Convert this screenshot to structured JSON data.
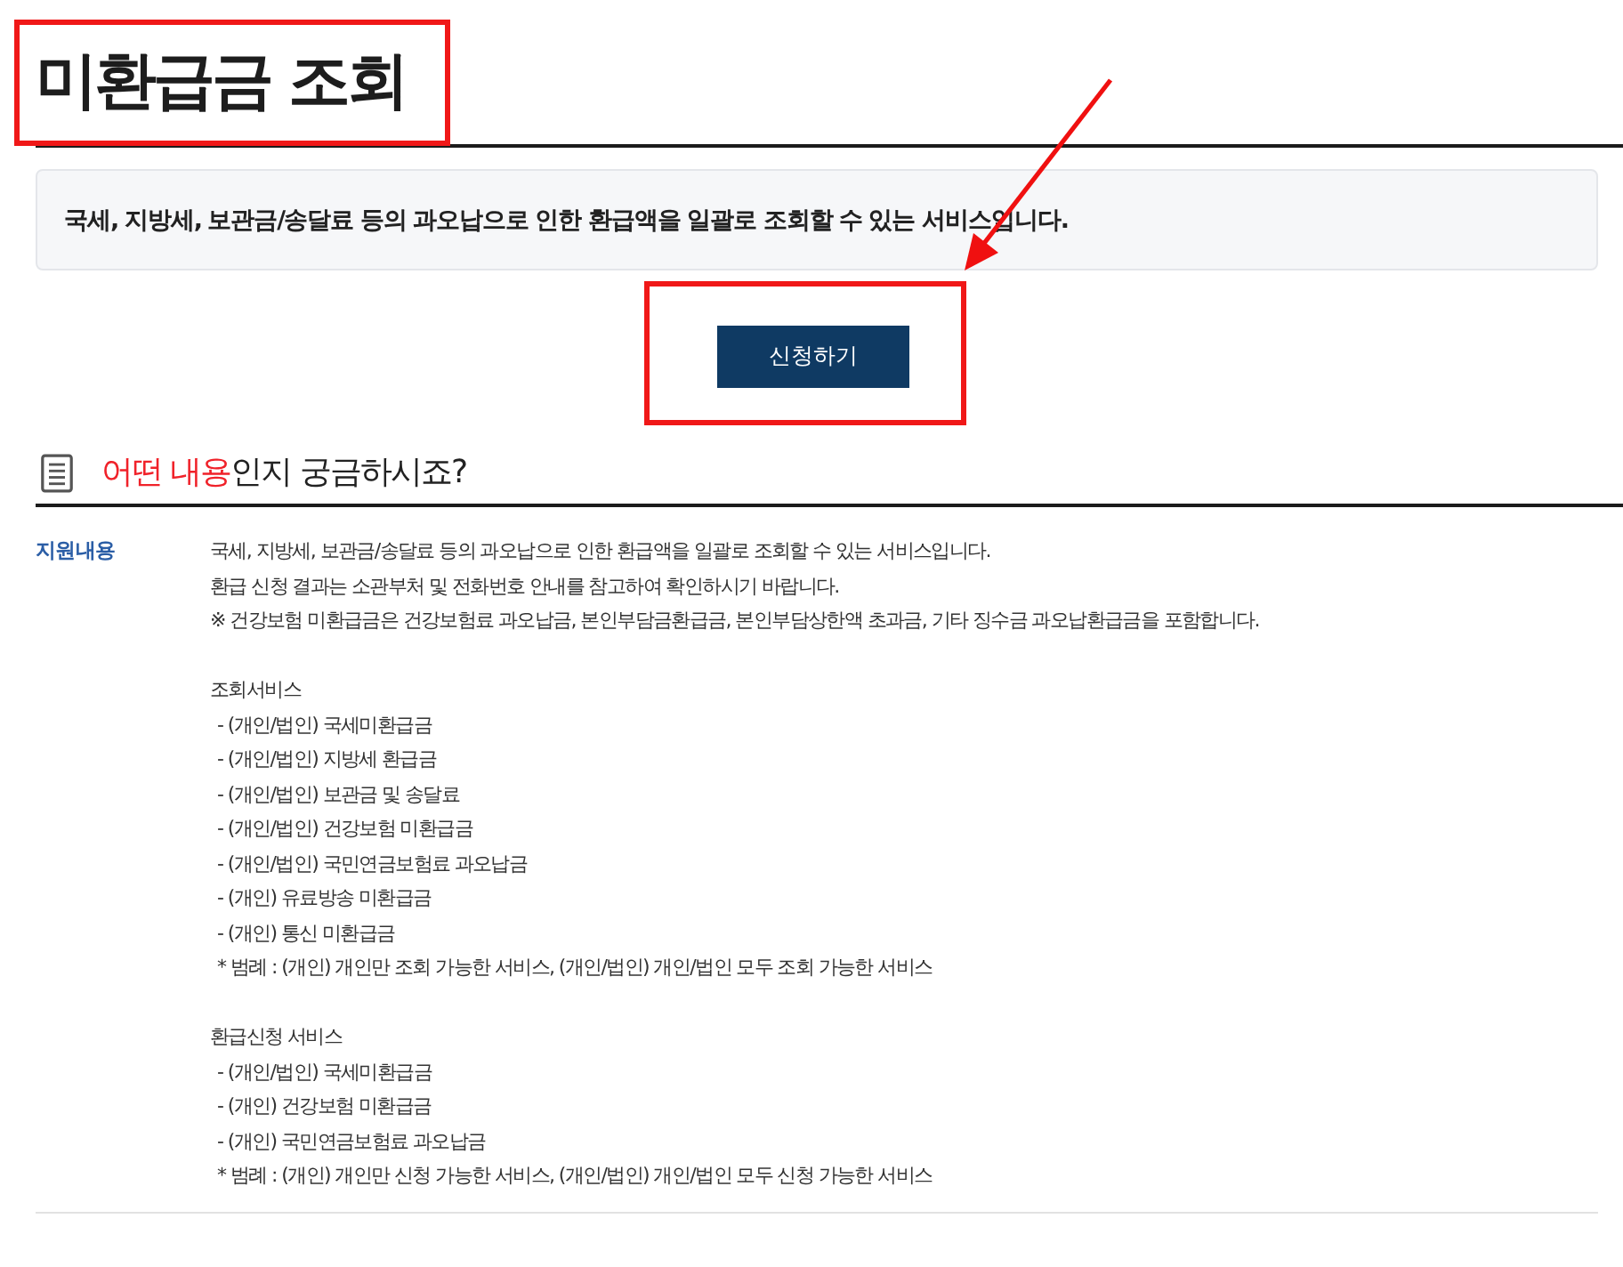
{
  "page_title": {
    "text": "미환급금 조회",
    "highlighted": true
  },
  "intro": "국세, 지방세, 보관금/송달료 등의 과오납으로 인한 환급액을 일괄로 조회할 수 있는 서비스입니다.",
  "apply_button": {
    "label": "신청하기",
    "highlighted": true
  },
  "pointer_arrow": true,
  "section": {
    "title_highlight": "어떤 내용",
    "title_rest": "인지 궁금하시죠?"
  },
  "details": [
    {
      "label": "지원내용",
      "blocks": [
        {
          "lines": [
            {
              "kind": "text",
              "text": "국세, 지방세, 보관금/송달료 등의 과오납으로 인한 환급액을 일괄로 조회할 수 있는 서비스입니다."
            },
            {
              "kind": "text",
              "text": "환급 신청 결과는 소관부처 및 전화번호 안내를 참고하여 확인하시기 바랍니다."
            },
            {
              "kind": "text",
              "text": "※ 건강보험 미환급금은 건강보험료 과오납금, 본인부담금환급금, 본인부담상한액 초과금, 기타 징수금 과오납환급금을 포함합니다."
            }
          ]
        },
        {
          "lines": [
            {
              "kind": "text",
              "text": "조회서비스"
            },
            {
              "kind": "item",
              "text": "- (개인/법인) 국세미환급금"
            },
            {
              "kind": "item",
              "text": "- (개인/법인) 지방세 환급금"
            },
            {
              "kind": "item",
              "text": "- (개인/법인) 보관금 및 송달료"
            },
            {
              "kind": "item",
              "text": "- (개인/법인) 건강보험 미환급금"
            },
            {
              "kind": "item",
              "text": "- (개인/법인) 국민연금보험료 과오납금"
            },
            {
              "kind": "item",
              "text": "- (개인) 유료방송 미환급금"
            },
            {
              "kind": "item",
              "text": "- (개인) 통신 미환급금"
            },
            {
              "kind": "note",
              "text": "* 범례 : (개인) 개인만 조회 가능한 서비스, (개인/법인) 개인/법인 모두 조회 가능한 서비스"
            }
          ]
        },
        {
          "lines": [
            {
              "kind": "text",
              "text": "환급신청 서비스"
            },
            {
              "kind": "item",
              "text": "- (개인/법인) 국세미환급금"
            },
            {
              "kind": "item",
              "text": "- (개인) 건강보험 미환급금"
            },
            {
              "kind": "item",
              "text": "- (개인) 국민연금보험료 과오납금"
            },
            {
              "kind": "note",
              "text": "* 범례 : (개인) 개인만 신청 가능한 서비스, (개인/법인) 개인/법인 모두 신청 가능한 서비스"
            }
          ]
        }
      ]
    }
  ]
}
